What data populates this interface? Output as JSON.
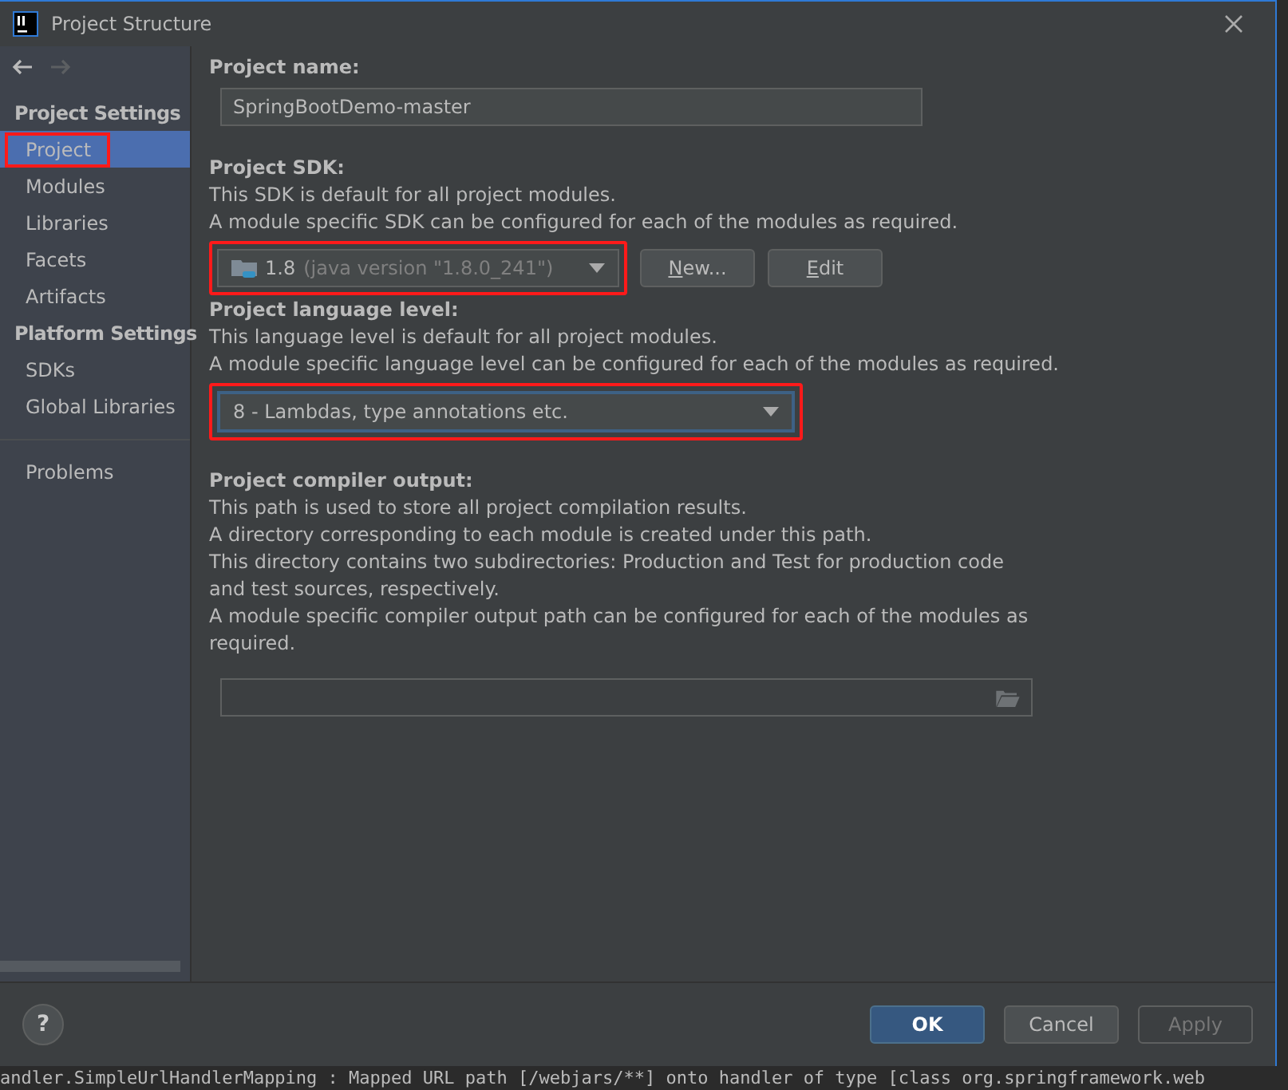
{
  "window": {
    "title": "Project Structure"
  },
  "sidebar": {
    "sections": [
      {
        "title": "Project Settings",
        "items": [
          {
            "label": "Project",
            "selected": true,
            "annotated": true
          },
          {
            "label": "Modules",
            "selected": false,
            "annotated": false
          },
          {
            "label": "Libraries",
            "selected": false,
            "annotated": false
          },
          {
            "label": "Facets",
            "selected": false,
            "annotated": false
          },
          {
            "label": "Artifacts",
            "selected": false,
            "annotated": false
          }
        ]
      },
      {
        "title": "Platform Settings",
        "items": [
          {
            "label": "SDKs",
            "selected": false,
            "annotated": false
          },
          {
            "label": "Global Libraries",
            "selected": false,
            "annotated": false
          }
        ]
      }
    ],
    "extra_items": [
      {
        "label": "Problems",
        "selected": false,
        "annotated": false
      }
    ]
  },
  "project_name": {
    "label": "Project name:",
    "value": "SpringBootDemo-master"
  },
  "project_sdk": {
    "label": "Project SDK:",
    "description": [
      "This SDK is default for all project modules.",
      "A module specific SDK can be configured for each of the modules as required."
    ],
    "value": "1.8",
    "value_detail": "(java version \"1.8.0_241\")",
    "annotated": true,
    "buttons": [
      {
        "label": "New...",
        "mnemonic_underlined": true
      },
      {
        "label": "Edit",
        "mnemonic_underlined": true
      }
    ]
  },
  "language_level": {
    "label": "Project language level:",
    "description": [
      "This language level is default for all project modules.",
      "A module specific language level can be configured for each of the modules as required."
    ],
    "value": "8 - Lambdas, type annotations etc.",
    "annotated": true
  },
  "compiler_output": {
    "label": "Project compiler output:",
    "description": [
      "This path is used to store all project compilation results.",
      "A directory corresponding to each module is created under this path.",
      "This directory contains two subdirectories: Production and Test for production code and test sources, respectively.",
      "A module specific compiler output path can be configured for each of the modules as required."
    ]
  },
  "footer": {
    "help": "?",
    "buttons": [
      {
        "label": "OK",
        "kind": "primary"
      },
      {
        "label": "Cancel",
        "kind": "normal"
      },
      {
        "label": "Apply",
        "kind": "disabled"
      }
    ]
  },
  "console_line": "andler.SimpleUrlHandlerMapping  : Mapped URL path [/webjars/**] onto handler of type [class org.springframework.web"
}
